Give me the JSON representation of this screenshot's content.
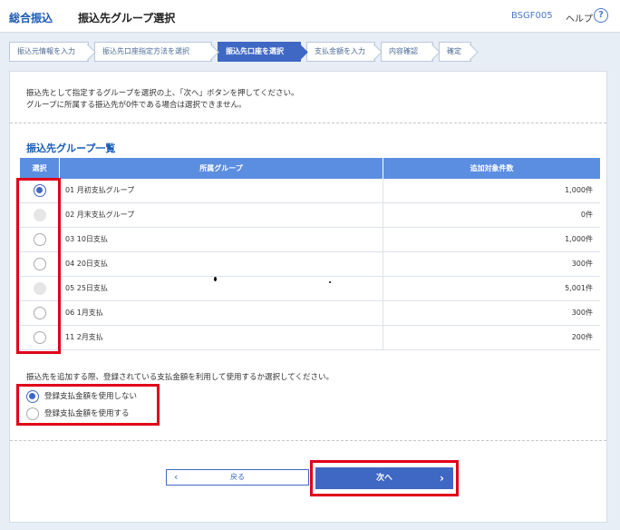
{
  "header": {
    "app_title": "総合振込",
    "page_title": "振込先グループ選択",
    "screen_id": "BSGF005",
    "help_label": "ヘルプ",
    "help_icon": "?"
  },
  "steps": [
    {
      "label": "振込元情報を入力",
      "active": false
    },
    {
      "label": "振込先口座指定方法を選択",
      "active": false
    },
    {
      "label": "振込先口座を選択",
      "active": true
    },
    {
      "label": "支払金額を入力",
      "active": false
    },
    {
      "label": "内容確認",
      "active": false
    },
    {
      "label": "確定",
      "active": false
    }
  ],
  "instructions": {
    "line1": "振込先として指定するグループを選択の上、「次へ」ボタンを押してください。",
    "line2": "グループに所属する振込先が0件である場合は選択できません。"
  },
  "section_title": "振込先グループ一覧",
  "table": {
    "headers": {
      "select": "選択",
      "group": "所属グループ",
      "count": "追加対象件数"
    },
    "rows": [
      {
        "group": "01 月初支払グループ",
        "count": "1,000件",
        "state": "checked"
      },
      {
        "group": "02 月末支払グループ",
        "count": "0件",
        "state": "disabled"
      },
      {
        "group": "03 10日支払",
        "count": "1,000件",
        "state": "unchecked"
      },
      {
        "group": "04 20日支払",
        "count": "300件",
        "state": "unchecked"
      },
      {
        "group": "05 25日支払",
        "count": "5,001件",
        "state": "disabled"
      },
      {
        "group": "06 1月支払",
        "count": "300件",
        "state": "unchecked"
      },
      {
        "group": "11 2月支払",
        "count": "200件",
        "state": "unchecked"
      }
    ]
  },
  "option": {
    "question": "振込先を追加する際、登録されている支払金額を利用して使用するか選択してください。",
    "choices": [
      {
        "label": "登録支払金額を使用しない",
        "state": "checked"
      },
      {
        "label": "登録支払金額を使用する",
        "state": "unchecked"
      }
    ]
  },
  "buttons": {
    "back": "戻る",
    "next": "次へ"
  },
  "colors": {
    "accent": "#3f68c4",
    "header_text": "#1a5bb5",
    "table_header": "#5b8ee0",
    "highlight": "#e0001a"
  }
}
